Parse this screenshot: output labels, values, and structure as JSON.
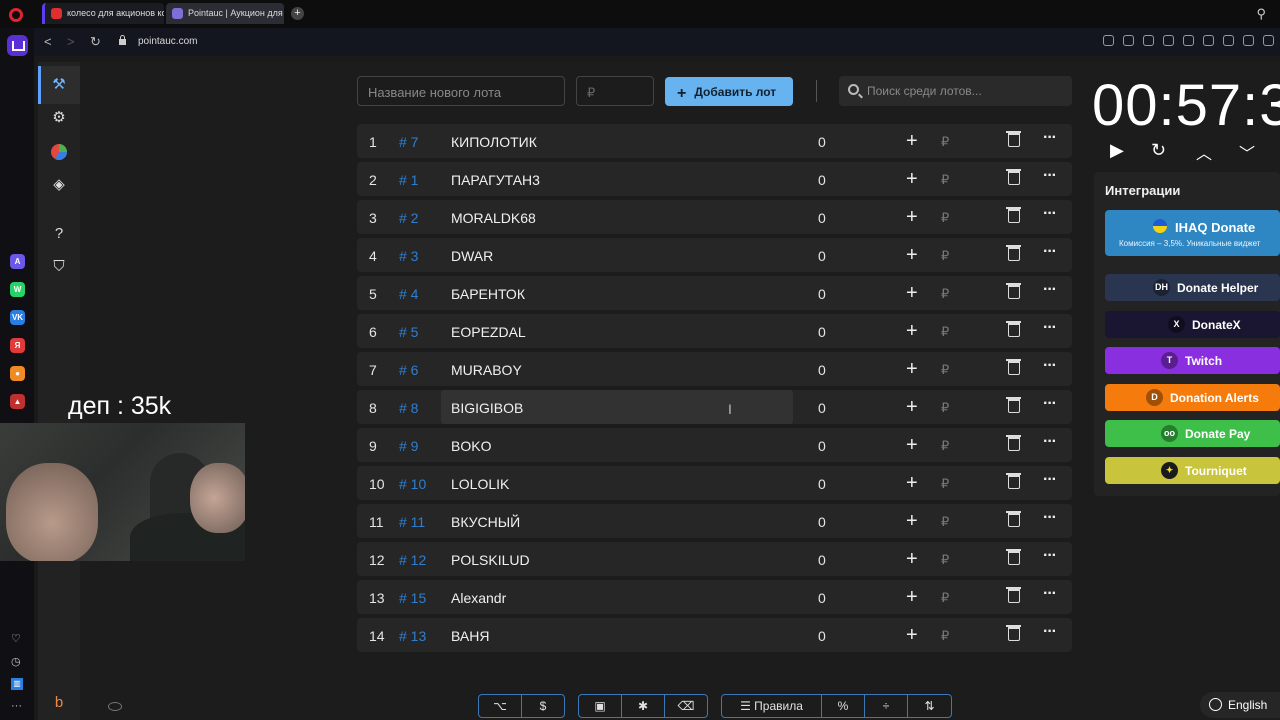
{
  "browser": {
    "tabs": [
      {
        "title": "колесо для акционов ко"
      },
      {
        "title": "Pointauc | Аукцион для ст"
      }
    ],
    "url": "pointauc.com"
  },
  "toolbar": {
    "new_lot_placeholder": "Название нового лота",
    "amount_placeholder": "₽",
    "add_button_label": "Добавить лот",
    "search_placeholder": "Поиск среди лотов..."
  },
  "lots": [
    {
      "index": "1",
      "id": "# 7",
      "name": "КИПОЛОТИК",
      "amount": "0"
    },
    {
      "index": "2",
      "id": "# 1",
      "name": "ПАРАГУТАН3",
      "amount": "0"
    },
    {
      "index": "3",
      "id": "# 2",
      "name": "MORALDK68",
      "amount": "0"
    },
    {
      "index": "4",
      "id": "# 3",
      "name": "DWAR",
      "amount": "0"
    },
    {
      "index": "5",
      "id": "# 4",
      "name": "БАРЕНТОК",
      "amount": "0"
    },
    {
      "index": "6",
      "id": "# 5",
      "name": "EOPEZDAL",
      "amount": "0"
    },
    {
      "index": "7",
      "id": "# 6",
      "name": "MURABOY",
      "amount": "0"
    },
    {
      "index": "8",
      "id": "# 8",
      "name": "BIGIGIBOB",
      "amount": "0"
    },
    {
      "index": "9",
      "id": "# 9",
      "name": "BOKO",
      "amount": "0"
    },
    {
      "index": "10",
      "id": "# 10",
      "name": "LOLOLIK",
      "amount": "0"
    },
    {
      "index": "11",
      "id": "# 11",
      "name": "ВКУСНЫЙ",
      "amount": "0"
    },
    {
      "index": "12",
      "id": "# 12",
      "name": "POLSKILUD",
      "amount": "0"
    },
    {
      "index": "13",
      "id": "# 15",
      "name": "Alexandr",
      "amount": "0"
    },
    {
      "index": "14",
      "id": "# 13",
      "name": "ВАНЯ",
      "amount": "0"
    }
  ],
  "row_plus": "+",
  "row_currency": "₽",
  "row_menu": "···",
  "overlay": {
    "dep_text": "деп : 35k"
  },
  "timer": {
    "display": "00:57:3"
  },
  "integrations": {
    "title": "Интеграции",
    "ihaq": {
      "label": "IHAQ Donate",
      "subtitle": "Комиссия – 3,5%. Уникальные виджет"
    },
    "buttons": [
      {
        "label": "Donate Helper",
        "icon_text": "DH",
        "color": "#2a3550"
      },
      {
        "label": "DonateX",
        "icon_text": "X",
        "color": "#1a1530"
      },
      {
        "label": "Twitch",
        "icon_text": "T",
        "color": "#8a2fdf"
      },
      {
        "label": "Donation Alerts",
        "icon_text": "D",
        "color": "#f57c0c"
      },
      {
        "label": "Donate Pay",
        "icon_text": "oo",
        "color": "#3dbf4a"
      },
      {
        "label": "Tourniquet",
        "icon_text": "✦",
        "color": "#c8c43b"
      }
    ]
  },
  "bottom_toolbar": {
    "rules_label": "Правила",
    "percent_label": "%",
    "dollar_label": "$"
  },
  "language": {
    "label": "English"
  }
}
